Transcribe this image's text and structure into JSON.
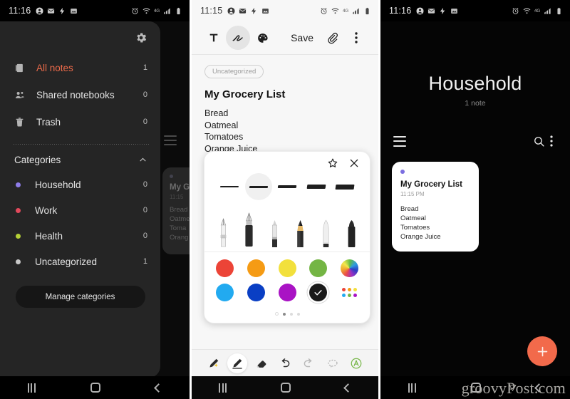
{
  "colors": {
    "accent_orange": "#eb6a4a",
    "fab": "#f26a4b",
    "drawer_bg": "#252525",
    "panel_dark": "#0b0b0b",
    "panel_light": "#f7f7f7",
    "note_dot_purple": "#7b6ee0"
  },
  "panel1": {
    "statusbar": {
      "time": "11:16"
    },
    "gear_icon": "gear-icon",
    "items": [
      {
        "label": "All notes",
        "count": "1",
        "icon": "notes-icon",
        "active": true
      },
      {
        "label": "Shared notebooks",
        "count": "0",
        "icon": "shared-people-icon",
        "active": false
      },
      {
        "label": "Trash",
        "count": "0",
        "icon": "trash-icon",
        "active": false
      }
    ],
    "categories_header": "Categories",
    "categories": [
      {
        "label": "Household",
        "count": "0",
        "color": "#8e7ce8"
      },
      {
        "label": "Work",
        "count": "0",
        "color": "#e2495c"
      },
      {
        "label": "Health",
        "count": "0",
        "color": "#b5d036"
      },
      {
        "label": "Uncategorized",
        "count": "1",
        "color": "#c9c9c9"
      }
    ],
    "manage_button": "Manage categories",
    "ghost_card": {
      "title": "My G",
      "time": "11:15",
      "lines": "Bread\nOatme\nToma\nOrang"
    }
  },
  "panel2": {
    "statusbar": {
      "time": "11:15"
    },
    "toolbar": {
      "text_tool": "text-tool-icon",
      "pen_tool": "handwriting-tool-icon",
      "palette_tool": "palette-tool-icon",
      "save_label": "Save",
      "attach_icon": "paperclip-icon",
      "more_icon": "more-vertical-icon"
    },
    "chip_label": "Uncategorized",
    "note_title": "My Grocery List",
    "note_body": "Bread\nOatmeal\nTomatoes\nOrange Juice",
    "pen_popup": {
      "favorite_icon": "star-icon",
      "close_icon": "close-icon",
      "stroke_widths": [
        1.5,
        2.5,
        4,
        5.5,
        7
      ],
      "selected_stroke_index": 1,
      "pens": [
        "fountain-pen",
        "calligraphy-pen",
        "ballpoint-pen",
        "pencil",
        "marker",
        "highlighter"
      ],
      "colors_row1": [
        "#ec4437",
        "#f59b14",
        "#f2e03c",
        "#74b544",
        "rainbow-wheel"
      ],
      "colors_row2": [
        "#22aaf0",
        "#0a3fc4",
        "#a913c4",
        "selected-black",
        "palette-grid"
      ],
      "selected_color": "#1a1a1a",
      "page_dots": 4,
      "page_dots_active_index": 1
    },
    "bottom_tools": [
      "pen-favorite-icon",
      "pen-icon",
      "eraser-icon",
      "undo-icon",
      "redo-icon",
      "lasso-select-icon",
      "text-recognition-icon"
    ],
    "bottom_tools_selected_index": 1
  },
  "panel3": {
    "statusbar": {
      "time": "11:16"
    },
    "title": "Household",
    "subtitle": "1 note",
    "menu_icon": "hamburger-menu-icon",
    "search_icon": "search-icon",
    "more_icon": "more-vertical-icon",
    "note_card": {
      "title": "My Grocery List",
      "time": "11:15 PM",
      "body": "Bread\nOatmeal\nTomatoes\nOrange Juice",
      "dot_color": "#7b6ee0"
    },
    "fab_icon": "plus-icon"
  },
  "watermark": {
    "text": "groovyPost.com"
  },
  "navbar": {
    "recents": "recents-icon",
    "home": "home-icon",
    "back": "back-icon"
  }
}
